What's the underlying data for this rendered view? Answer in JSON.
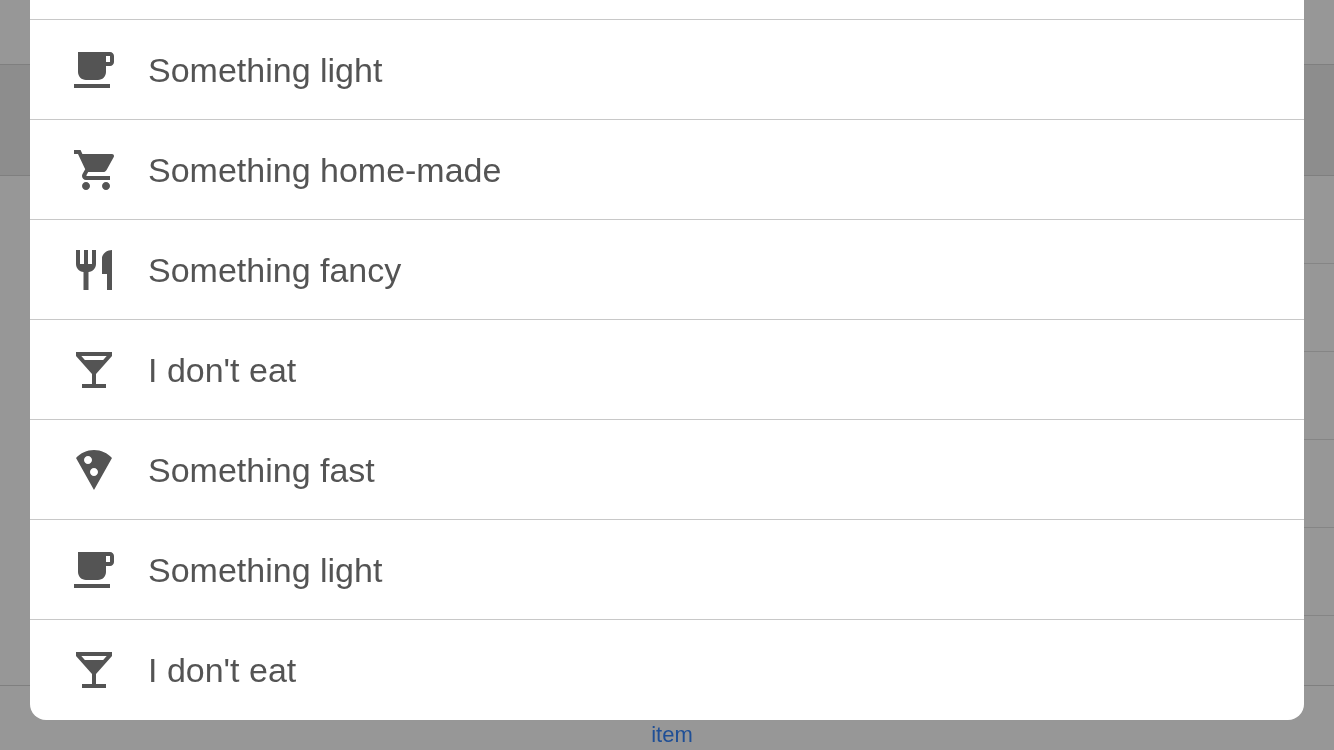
{
  "background": {
    "link": "item"
  },
  "sheet": {
    "options": [
      {
        "kind": "cup",
        "label": "Something light"
      },
      {
        "kind": "cart",
        "label": "Something home-made"
      },
      {
        "kind": "cutlery",
        "label": "Something fancy"
      },
      {
        "kind": "glass",
        "label": "I don't eat"
      },
      {
        "kind": "pizza",
        "label": "Something fast"
      },
      {
        "kind": "cup",
        "label": "Something light"
      },
      {
        "kind": "glass",
        "label": "I don't eat"
      }
    ]
  }
}
